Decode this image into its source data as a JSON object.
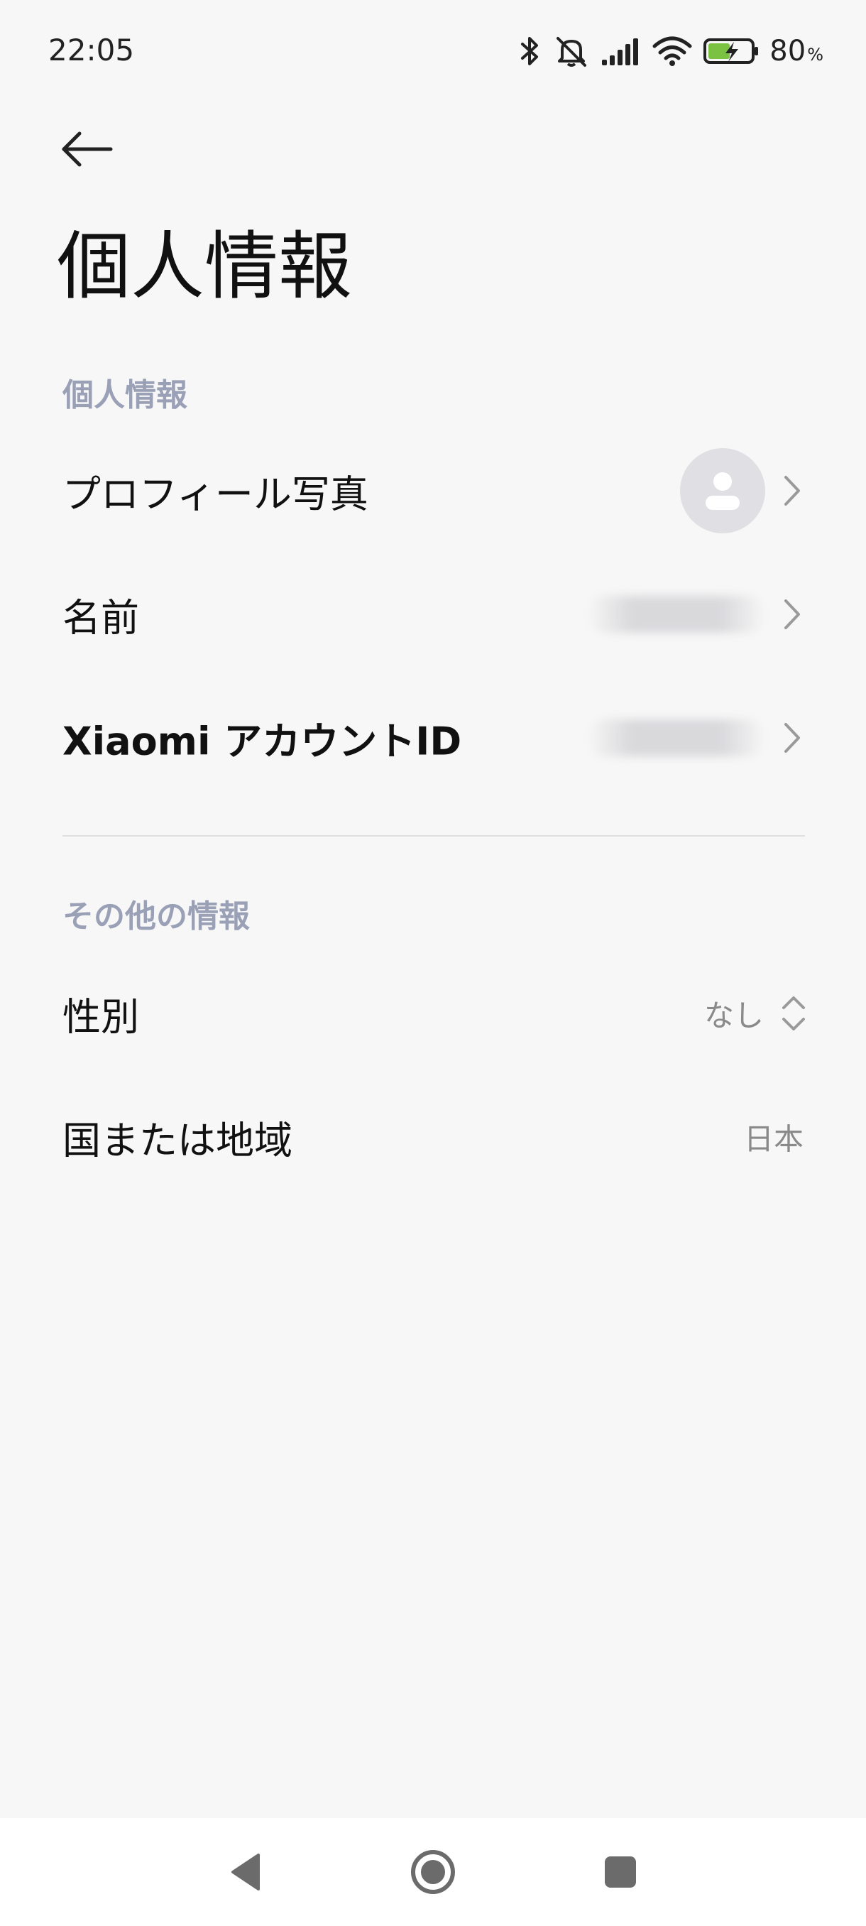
{
  "status_bar": {
    "time": "22:05",
    "battery_percent": "80",
    "battery_unit": "%",
    "icons": [
      "bluetooth-icon",
      "muted-bell-icon",
      "signal-icon",
      "wifi-icon",
      "battery-charging-icon"
    ],
    "battery_color": "#7cc242"
  },
  "header": {
    "back_icon": "arrow-left-icon",
    "title": "個人情報"
  },
  "personal_section": {
    "header": "個人情報",
    "rows": [
      {
        "label": "プロフィール写真",
        "value_type": "avatar",
        "icon": "person-icon"
      },
      {
        "label": "名前",
        "value_type": "blurred"
      },
      {
        "label": "Xiaomi アカウントID",
        "value_type": "blurred"
      }
    ]
  },
  "other_section": {
    "header": "その他の情報",
    "rows": [
      {
        "label": "性別",
        "value": "なし",
        "icon": "up-down-chevron-icon"
      },
      {
        "label": "国または地域",
        "value": "日本"
      }
    ]
  },
  "nav_bar": {
    "buttons": [
      "back-triangle-icon",
      "home-circle-icon",
      "recents-square-icon"
    ]
  },
  "colors": {
    "background": "#f7f7f7",
    "section_header": "#9aa0b5",
    "value_text": "#8a8a8a",
    "nav_icon": "#6b6b6b"
  }
}
